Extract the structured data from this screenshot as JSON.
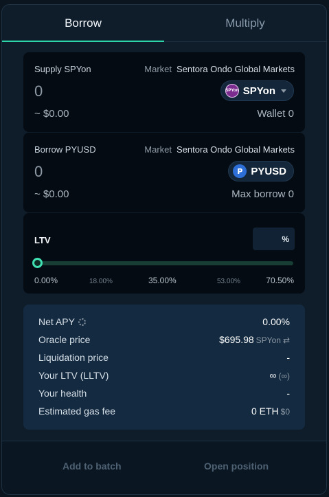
{
  "tabs": {
    "borrow": "Borrow",
    "multiply": "Multiply"
  },
  "supply": {
    "label": "Supply SPYon",
    "market_label": "Market",
    "market_value": "Sentora Ondo Global Markets",
    "amount": "0",
    "usd": "~ $0.00",
    "token": "SPYon",
    "token_icon_text": "SPYon",
    "wallet": "Wallet 0"
  },
  "borrow": {
    "label": "Borrow PYUSD",
    "market_label": "Market",
    "market_value": "Sentora Ondo Global Markets",
    "amount": "0",
    "usd": "~ $0.00",
    "token": "PYUSD",
    "token_icon_text": "P",
    "max_borrow": "Max borrow 0"
  },
  "ltv": {
    "label": "LTV",
    "input_unit": "%",
    "value_fraction": 0,
    "ticks": [
      "0.00%",
      "18.00%",
      "35.00%",
      "53.00%",
      "70.50%"
    ]
  },
  "info": {
    "net_apy_label": "Net APY",
    "net_apy_value": "0.00%",
    "oracle_label": "Oracle price",
    "oracle_value": "$695.98",
    "oracle_unit": "SPYon",
    "liq_label": "Liquidation price",
    "liq_value": "-",
    "ltv_label": "Your LTV (LLTV)",
    "ltv_value": "∞",
    "ltv_sub": "(∞)",
    "health_label": "Your health",
    "health_value": "-",
    "gas_label": "Estimated gas fee",
    "gas_value": "0 ETH",
    "gas_sub": "$0"
  },
  "footer": {
    "add_batch": "Add to batch",
    "open_position": "Open position"
  },
  "colors": {
    "accent": "#2dd4a7",
    "panel": "#0f1d2b",
    "card": "#050b12",
    "info": "#132a40"
  },
  "icons": {
    "settings": "gear-icon",
    "swap": "swap-icon",
    "dropdown": "chevron-down-icon"
  }
}
